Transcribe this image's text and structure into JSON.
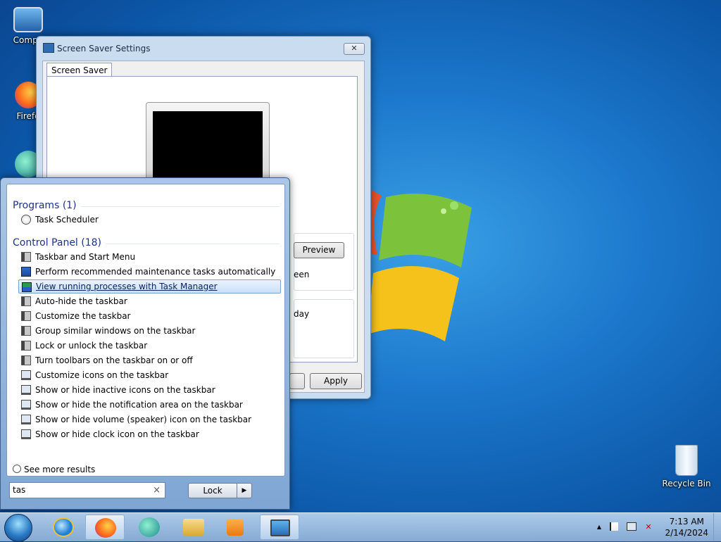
{
  "desktop": {
    "icons": [
      {
        "label": "Compu"
      },
      {
        "label": "Firefo"
      },
      {
        "label": "Recycle Bin"
      }
    ]
  },
  "screensaver_window": {
    "title": "Screen Saver Settings",
    "close_label": "✕",
    "tab_label": "Screen Saver",
    "preview_label": "Preview",
    "frag_een": "een",
    "frag_day": "day",
    "apply_label": "Apply"
  },
  "start_menu": {
    "programs_header": "Programs (1)",
    "programs": [
      {
        "label": "Task Scheduler"
      }
    ],
    "control_panel_header": "Control Panel (18)",
    "control_panel": [
      {
        "label": "Taskbar and Start Menu"
      },
      {
        "label": "Perform recommended maintenance tasks automatically"
      },
      {
        "label": "View running processes with Task Manager"
      },
      {
        "label": "Auto-hide the taskbar"
      },
      {
        "label": "Customize the taskbar"
      },
      {
        "label": "Group similar windows on the taskbar"
      },
      {
        "label": "Lock or unlock the taskbar"
      },
      {
        "label": "Turn toolbars on the taskbar on or off"
      },
      {
        "label": "Customize icons on the taskbar"
      },
      {
        "label": "Show or hide inactive icons on the taskbar"
      },
      {
        "label": "Show or hide the notification area on the taskbar"
      },
      {
        "label": "Show or hide volume (speaker) icon on the taskbar"
      },
      {
        "label": "Show or hide clock icon on the taskbar"
      }
    ],
    "see_more": "See more results",
    "search_value": "tas",
    "clear_label": "×",
    "lock_label": "Lock",
    "lock_arrow": "▶"
  },
  "taskbar": {
    "clock_time": "7:13 AM",
    "clock_date": "2/14/2024",
    "tray_up": "▲"
  }
}
